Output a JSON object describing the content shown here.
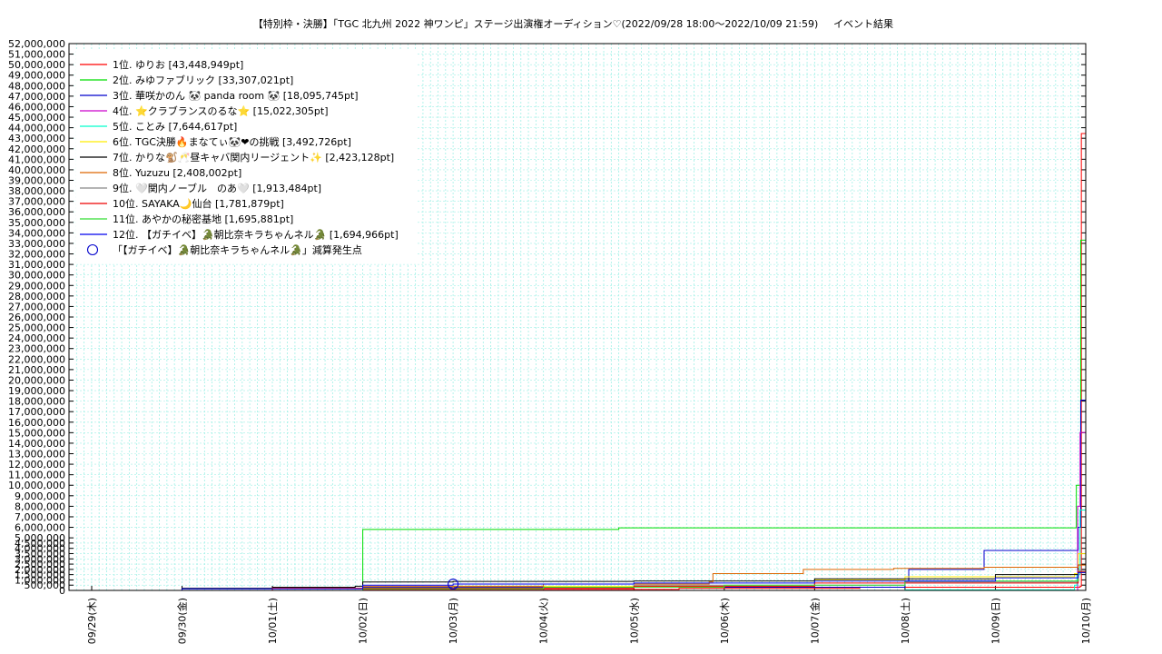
{
  "chart_data": {
    "type": "line",
    "title": "【特別枠・決勝】「TGC 北九州 2022 神ワンピ」ステージ出演権オーディション♡(2022/09/28 18:00〜2022/10/09 21:59)",
    "subtitle": "イベント結果",
    "xlabel": "",
    "ylabel": "",
    "x_ticks": [
      "09/29(木)",
      "09/30(金)",
      "10/01(土)",
      "10/02(日)",
      "10/03(月)",
      "10/04(火)",
      "10/05(水)",
      "10/06(木)",
      "10/07(金)",
      "10/08(土)",
      "10/09(日)",
      "10/10(月)"
    ],
    "x_range": [
      "2022-09-28T18:00",
      "2022-10-10T00:00"
    ],
    "ylim": [
      0,
      52000000
    ],
    "y_ticks": [
      0,
      500000,
      1000000,
      1500000,
      2000000,
      2500000,
      3000000,
      3500000,
      4000000,
      4500000,
      5000000,
      6000000,
      7000000,
      8000000,
      9000000,
      10000000,
      11000000,
      12000000,
      13000000,
      14000000,
      15000000,
      16000000,
      17000000,
      18000000,
      19000000,
      20000000,
      21000000,
      22000000,
      23000000,
      24000000,
      25000000,
      26000000,
      27000000,
      28000000,
      29000000,
      30000000,
      31000000,
      32000000,
      33000000,
      34000000,
      35000000,
      36000000,
      37000000,
      38000000,
      39000000,
      40000000,
      41000000,
      42000000,
      43000000,
      44000000,
      45000000,
      46000000,
      47000000,
      48000000,
      49000000,
      50000000,
      51000000,
      52000000
    ],
    "y_tick_labels": [
      "0",
      "500,000",
      "1,000,000",
      "1,500,000",
      "2,000,000",
      "2,500,000",
      "3,000,000",
      "3,500,000",
      "4,000,000",
      "4,500,000",
      "5,000,000",
      "6,000,000",
      "7,000,000",
      "8,000,000",
      "9,000,000",
      "10,000,000",
      "11,000,000",
      "12,000,000",
      "13,000,000",
      "14,000,000",
      "15,000,000",
      "16,000,000",
      "17,000,000",
      "18,000,000",
      "19,000,000",
      "20,000,000",
      "21,000,000",
      "22,000,000",
      "23,000,000",
      "24,000,000",
      "25,000,000",
      "26,000,000",
      "27,000,000",
      "28,000,000",
      "29,000,000",
      "30,000,000",
      "31,000,000",
      "32,000,000",
      "33,000,000",
      "34,000,000",
      "35,000,000",
      "36,000,000",
      "37,000,000",
      "38,000,000",
      "39,000,000",
      "40,000,000",
      "41,000,000",
      "42,000,000",
      "43,000,000",
      "44,000,000",
      "45,000,000",
      "46,000,000",
      "47,000,000",
      "48,000,000",
      "49,000,000",
      "50,000,000",
      "51,000,000",
      "52,000,000"
    ],
    "grid": true,
    "legend_position": "top-left",
    "series": [
      {
        "name": "1位. ゆりお [43,448,949pt]",
        "color": "#ff0000",
        "x": [
          "2022-09-28T18:00",
          "2022-10-02T00:00",
          "2022-10-05T12:00",
          "2022-10-07T12:00",
          "2022-10-09T22:30",
          "2022-10-09T22:50",
          "2022-10-10T00:00"
        ],
        "y": [
          0,
          100000,
          200000,
          300000,
          400000,
          43448949,
          43448949
        ]
      },
      {
        "name": "2位. みゆファブリック [33,307,021pt]",
        "color": "#00dd00",
        "x": [
          "2022-09-28T18:00",
          "2022-10-02T00:00",
          "2022-10-02T00:01",
          "2022-10-04T20:00",
          "2022-10-09T20:00",
          "2022-10-09T21:30",
          "2022-10-09T22:40",
          "2022-10-10T00:00"
        ],
        "y": [
          0,
          600000,
          5800000,
          5950000,
          5950000,
          10000000,
          33307021,
          33307021
        ]
      },
      {
        "name": "3位. 華咲かのん 🐼 panda room 🐼 [18,095,745pt]",
        "color": "#0000cc",
        "x": [
          "2022-09-28T18:00",
          "2022-10-02T00:00",
          "2022-10-08T00:00",
          "2022-10-08T01:00",
          "2022-10-08T20:00",
          "2022-10-08T21:00",
          "2022-10-09T21:00",
          "2022-10-09T22:00",
          "2022-10-09T22:40",
          "2022-10-10T00:00"
        ],
        "y": [
          0,
          300000,
          900000,
          2000000,
          2000000,
          3800000,
          3800000,
          6000000,
          18095745,
          18095745
        ]
      },
      {
        "name": "4位. ⭐クラブランスのるな⭐ [15,022,305pt]",
        "color": "#cc00cc",
        "x": [
          "2022-09-28T18:00",
          "2022-10-09T21:00",
          "2022-10-09T21:50",
          "2022-10-09T22:30",
          "2022-10-10T00:00"
        ],
        "y": [
          0,
          0,
          8000000,
          15022305,
          15022305
        ]
      },
      {
        "name": "5位. ことみ [7,644,617pt]",
        "color": "#00ffcc",
        "x": [
          "2022-09-28T18:00",
          "2022-10-08T00:00",
          "2022-10-09T21:00",
          "2022-10-09T21:40",
          "2022-10-09T22:30",
          "2022-10-10T00:00"
        ],
        "y": [
          0,
          50000,
          500000,
          1500000,
          7644617,
          7644617
        ]
      },
      {
        "name": "6位. TGC決勝🔥まなてぃ🐼❤の挑戦 [3,492,726pt]",
        "color": "#ffee00",
        "x": [
          "2022-09-28T18:00",
          "2022-10-03T00:00",
          "2022-10-07T00:00",
          "2022-10-08T00:00",
          "2022-10-09T21:00",
          "2022-10-09T22:00",
          "2022-10-10T00:00"
        ],
        "y": [
          0,
          400000,
          1000000,
          1300000,
          1600000,
          3492726,
          3492726
        ]
      },
      {
        "name": "7位. かりな🐒🥂昼キャバ関内リージェント✨ [2,423,128pt]",
        "color": "#000000",
        "x": [
          "2022-09-28T18:00",
          "2022-09-30T00:00",
          "2022-10-01T00:00",
          "2022-10-01T22:00",
          "2022-10-02T00:00",
          "2022-10-03T00:00",
          "2022-10-05T00:00",
          "2022-10-07T00:00",
          "2022-10-09T00:00",
          "2022-10-09T22:00",
          "2022-10-10T00:00"
        ],
        "y": [
          0,
          200000,
          300000,
          400000,
          800000,
          850000,
          900000,
          1100000,
          1500000,
          2423128,
          2423128
        ]
      },
      {
        "name": "8位. Yuzuzu [2,408,002pt]",
        "color": "#dd6600",
        "x": [
          "2022-09-28T18:00",
          "2022-10-02T00:00",
          "2022-10-04T00:00",
          "2022-10-05T20:00",
          "2022-10-05T21:00",
          "2022-10-06T20:00",
          "2022-10-06T21:00",
          "2022-10-07T20:00",
          "2022-10-07T21:00",
          "2022-10-08T20:00",
          "2022-10-08T21:00",
          "2022-10-09T21:00",
          "2022-10-09T22:00",
          "2022-10-10T00:00"
        ],
        "y": [
          0,
          400000,
          600000,
          800000,
          1600000,
          1600000,
          2000000,
          2000000,
          2100000,
          2100000,
          2200000,
          2200000,
          2408002,
          2408002
        ]
      },
      {
        "name": "9位. 🤍関内ノーブル　のあ🤍 [1,913,484pt]",
        "color": "#888888",
        "x": [
          "2022-09-28T18:00",
          "2022-10-02T00:00",
          "2022-10-05T00:00",
          "2022-10-08T00:00",
          "2022-10-09T22:00",
          "2022-10-10T00:00"
        ],
        "y": [
          0,
          250000,
          500000,
          800000,
          1913484,
          1913484
        ]
      },
      {
        "name": "10位. SAYAKA🌙仙台 [1,781,879pt]",
        "color": "#ee0000",
        "x": [
          "2022-09-28T18:00",
          "2022-10-01T00:00",
          "2022-10-05T00:00",
          "2022-10-07T00:00",
          "2022-10-09T22:00",
          "2022-10-10T00:00"
        ],
        "y": [
          0,
          200000,
          400000,
          700000,
          1781879,
          1781879
        ]
      },
      {
        "name": "11位. あやかの秘密基地 [1,695,881pt]",
        "color": "#33dd33",
        "x": [
          "2022-09-28T18:00",
          "2022-10-02T00:00",
          "2022-10-04T00:00",
          "2022-10-06T00:00",
          "2022-10-08T00:00",
          "2022-10-09T22:00",
          "2022-10-10T00:00"
        ],
        "y": [
          0,
          150000,
          300000,
          500000,
          900000,
          1695881,
          1695881
        ]
      },
      {
        "name": "12位. 【ガチイベ】🐊朝比奈キラちゃんネル🐊 [1,694,966pt]",
        "color": "#0000ee",
        "x": [
          "2022-09-28T18:00",
          "2022-09-30T00:00",
          "2022-10-02T00:00",
          "2022-10-03T00:00",
          "2022-10-05T00:00",
          "2022-10-07T00:00",
          "2022-10-09T00:00",
          "2022-10-09T22:00",
          "2022-10-10T00:00"
        ],
        "y": [
          0,
          150000,
          500000,
          600000,
          700000,
          900000,
          1200000,
          1694966,
          1694966
        ]
      }
    ],
    "annotations": [
      {
        "name": "「【ガチイベ】🐊朝比奈キラちゃんネル🐊」減算発生点",
        "color": "#0000cc",
        "marker": "open-circle",
        "x": "2022-10-03T00:00",
        "y": 600000
      }
    ]
  }
}
